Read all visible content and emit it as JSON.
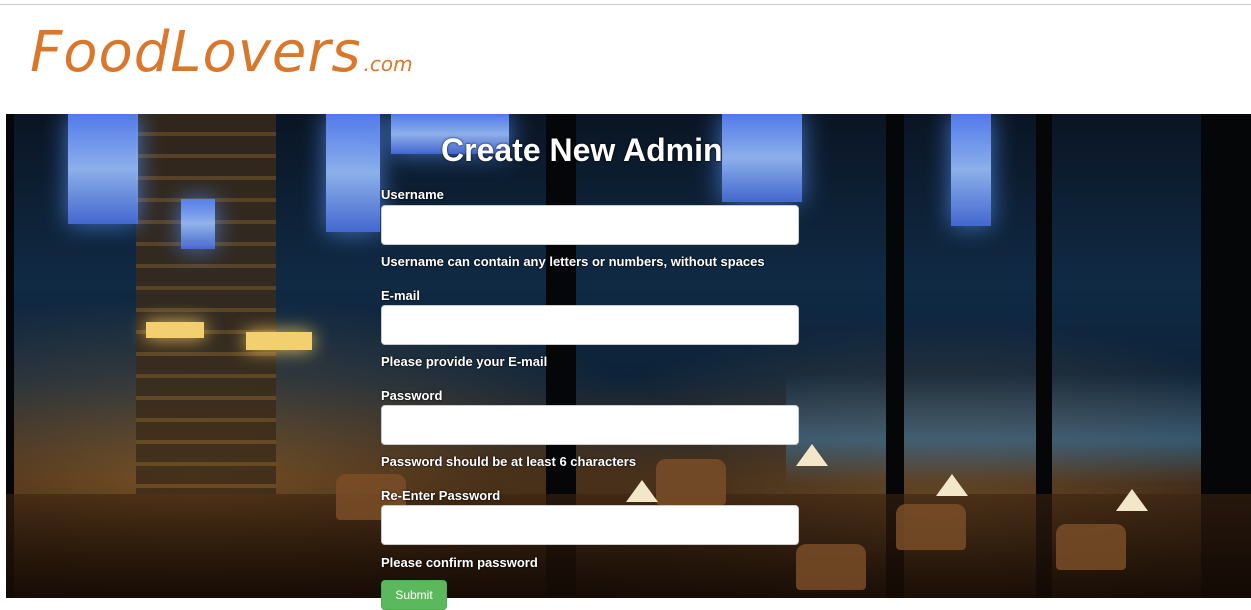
{
  "logo": {
    "main": "FoodLovers",
    "suffix": ".com"
  },
  "form": {
    "title": "Create New Admin",
    "username": {
      "label": "Username",
      "value": "",
      "placeholder": "",
      "help": "Username can contain any letters or numbers, without spaces"
    },
    "email": {
      "label": "E-mail",
      "value": "",
      "placeholder": "",
      "help": "Please provide your E-mail"
    },
    "password": {
      "label": "Password",
      "value": "",
      "placeholder": "",
      "help": "Password should be at least 6 characters"
    },
    "reenter": {
      "label": "Re-Enter Password",
      "value": "",
      "placeholder": "",
      "help": "Please confirm password"
    },
    "submit_label": "Submit"
  },
  "colors": {
    "brand": "#d9782d",
    "submit": "#5cb85c"
  }
}
